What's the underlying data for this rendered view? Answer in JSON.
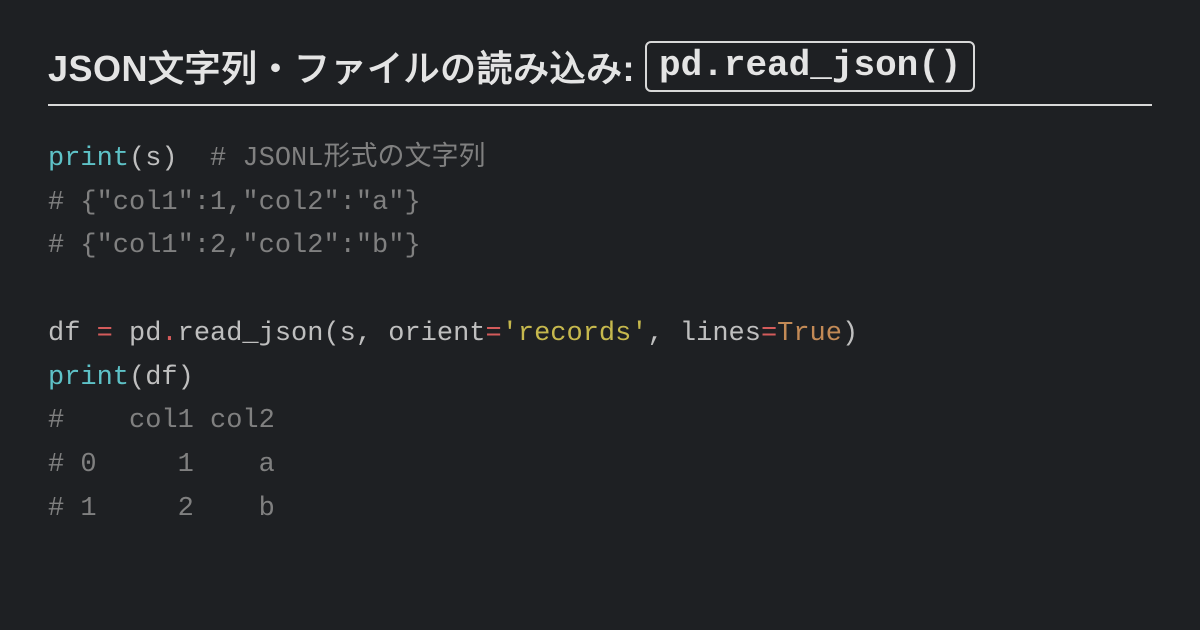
{
  "header": {
    "title_prefix": "JSON文字列・ファイルの読み込み: ",
    "title_code": "pd.read_json()"
  },
  "code": {
    "l1_fn": "print",
    "l1_open": "(",
    "l1_arg": "s",
    "l1_close": ")",
    "l1_spaces": "  ",
    "l1_comment": "# JSONL形式の文字列",
    "l2": "# {\"col1\":1,\"col2\":\"a\"}",
    "l3": "# {\"col1\":2,\"col2\":\"b\"}",
    "l5_lhs": "df ",
    "l5_eq": "=",
    "l5_sp1": " ",
    "l5_obj": "pd",
    "l5_dot": ".",
    "l5_fn": "read_json",
    "l5_open": "(",
    "l5_a1": "s",
    "l5_c1": ",",
    "l5_sp2": " ",
    "l5_a2": "orient",
    "l5_eq2": "=",
    "l5_str": "'records'",
    "l5_c2": ",",
    "l5_sp3": " ",
    "l5_a3": "lines",
    "l5_eq3": "=",
    "l5_true": "True",
    "l5_close": ")",
    "l6_fn": "print",
    "l6_open": "(",
    "l6_arg": "df",
    "l6_close": ")",
    "l7": "#    col1 col2",
    "l8": "# 0     1    a",
    "l9": "# 1     2    b"
  }
}
